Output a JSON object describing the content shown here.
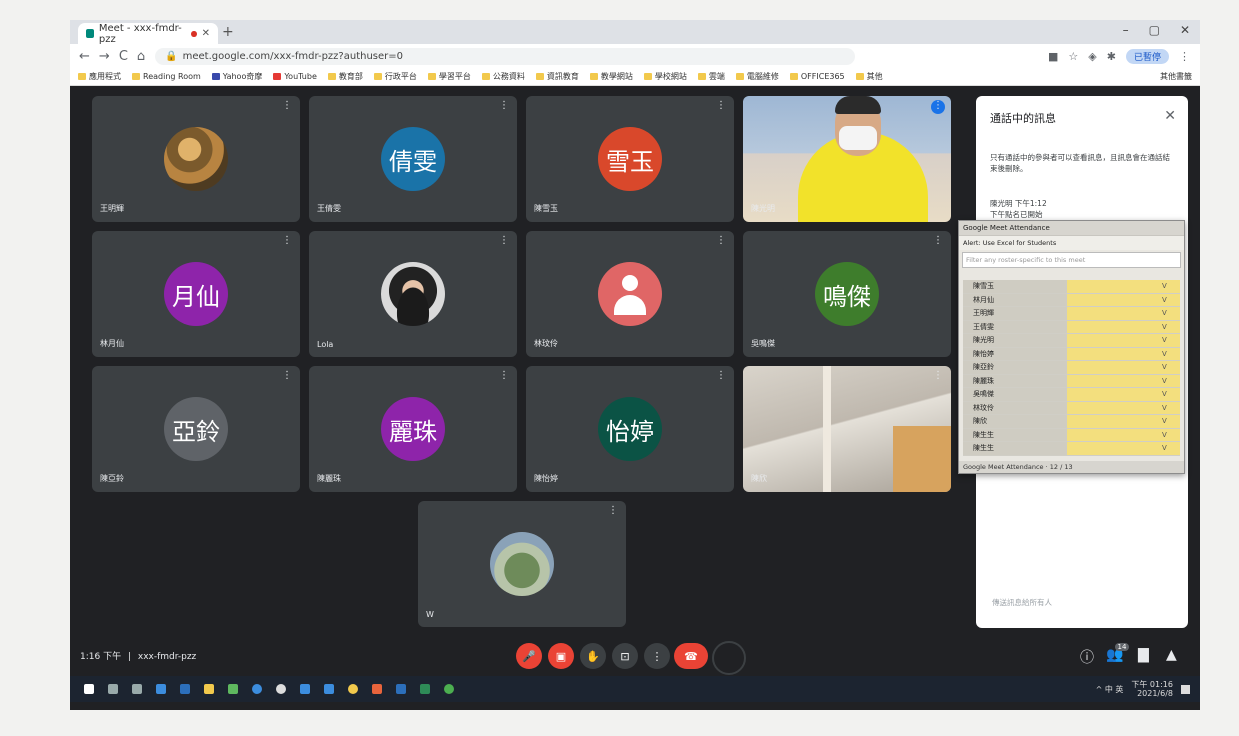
{
  "browser": {
    "tab_title": "Meet - xxx-fmdr-pzz",
    "url": "meet.google.com/xxx-fmdr-pzz?authuser=0",
    "pause_label": "已暫停",
    "win_minimize": "–",
    "win_maximize": "▢",
    "win_close": "✕",
    "new_tab": "+",
    "back": "←",
    "forward": "→",
    "reload": "C",
    "home": "⌂",
    "bookmarks": [
      {
        "label": "應用程式",
        "icon": "apps-icon"
      },
      {
        "label": "Reading Room",
        "icon": "folder-icon"
      },
      {
        "label": "Yahoo奇摩",
        "icon": "yahoo-icon"
      },
      {
        "label": "YouTube",
        "icon": "youtube-icon"
      },
      {
        "label": "教育部",
        "icon": "folder-icon"
      },
      {
        "label": "行政平台",
        "icon": "folder-icon"
      },
      {
        "label": "學習平台",
        "icon": "folder-icon"
      },
      {
        "label": "公務資料",
        "icon": "folder-icon"
      },
      {
        "label": "資訊教育",
        "icon": "folder-icon"
      },
      {
        "label": "教學網站",
        "icon": "folder-icon"
      },
      {
        "label": "學校網站",
        "icon": "folder-icon"
      },
      {
        "label": "雲端",
        "icon": "folder-icon"
      },
      {
        "label": "電腦維修",
        "icon": "folder-icon"
      },
      {
        "label": "OFFICE365",
        "icon": "folder-icon"
      },
      {
        "label": "其他",
        "icon": "folder-icon"
      }
    ],
    "other_bookmarks": "其他書籤"
  },
  "tiles": [
    {
      "name": "王明輝",
      "initials": "",
      "type": "photo",
      "photo": "photo1"
    },
    {
      "name": "王倩雯",
      "initials": "倩雯",
      "type": "initials",
      "color": "#1a73a8"
    },
    {
      "name": "陳雪玉",
      "initials": "雪玉",
      "type": "initials",
      "color": "#d9482b"
    },
    {
      "name": "陳光明",
      "initials": "",
      "type": "video",
      "video": "vid1"
    },
    {
      "name": "林月仙",
      "initials": "月仙",
      "type": "initials",
      "color": "#8e24aa"
    },
    {
      "name": "Lola",
      "initials": "",
      "type": "photo",
      "photo": "photo2"
    },
    {
      "name": "林玟伶",
      "initials": "",
      "type": "usericon"
    },
    {
      "name": "吳鳴傑",
      "initials": "鳴傑",
      "type": "initials",
      "color": "#3e7d2c"
    },
    {
      "name": "陳亞鈴",
      "initials": "亞鈴",
      "type": "initials",
      "color": "#5f6368"
    },
    {
      "name": "陳麗珠",
      "initials": "麗珠",
      "type": "initials",
      "color": "#8e24aa"
    },
    {
      "name": "陳怡婷",
      "initials": "怡婷",
      "type": "initials",
      "color": "#0b5345"
    },
    {
      "name": "陳欣",
      "initials": "",
      "type": "video",
      "video": "vid2"
    },
    {
      "name": "W",
      "initials": "",
      "type": "photo",
      "photo": "photo3"
    }
  ],
  "tile_more_icon": "⋮",
  "meeting": {
    "time": "1:16 下午",
    "separator": "|",
    "code": "xxx-fmdr-pzz"
  },
  "controls": {
    "mic": "🎤",
    "cam": "▣",
    "hand": "✋",
    "present": "⊡",
    "more": "⋮",
    "end": "☎",
    "info": "ⓘ",
    "people": "👥",
    "people_count": "14",
    "chat": "▇",
    "activities": "▲"
  },
  "panel": {
    "title": "通話中的訊息",
    "close": "✕",
    "notice": "只有通話中的參與者可以查看訊息，且訊息會在通話結束後刪除。",
    "info1": "陳光明 下午1:12",
    "info2": "下午點名已開始",
    "footer": "傳送訊息給所有人"
  },
  "attendance": {
    "title": "Google Meet Attendance",
    "tool": "Alert: Use Excel for Students",
    "search_placeholder": "Filter any roster-specific to this meet",
    "status": "Google Meet Attendance  ·  12 / 13",
    "rows": [
      {
        "name": "陳雪玉",
        "mark": "V"
      },
      {
        "name": "林月仙",
        "mark": "V"
      },
      {
        "name": "王明輝",
        "mark": "V"
      },
      {
        "name": "王倩雯",
        "mark": "V"
      },
      {
        "name": "陳光明",
        "mark": "V"
      },
      {
        "name": "陳怡婷",
        "mark": "V"
      },
      {
        "name": "陳亞鈴",
        "mark": "V"
      },
      {
        "name": "陳麗珠",
        "mark": "V"
      },
      {
        "name": "吳鳴傑",
        "mark": "V"
      },
      {
        "name": "林玟伶",
        "mark": "V"
      },
      {
        "name": "陳欣",
        "mark": "V"
      },
      {
        "name": "陳生生",
        "mark": "V"
      },
      {
        "name": "陳生生",
        "mark": "V"
      }
    ]
  },
  "taskbar": {
    "time": "下午 01:16",
    "date": "2021/6/8",
    "tray": "^ 中 英"
  }
}
